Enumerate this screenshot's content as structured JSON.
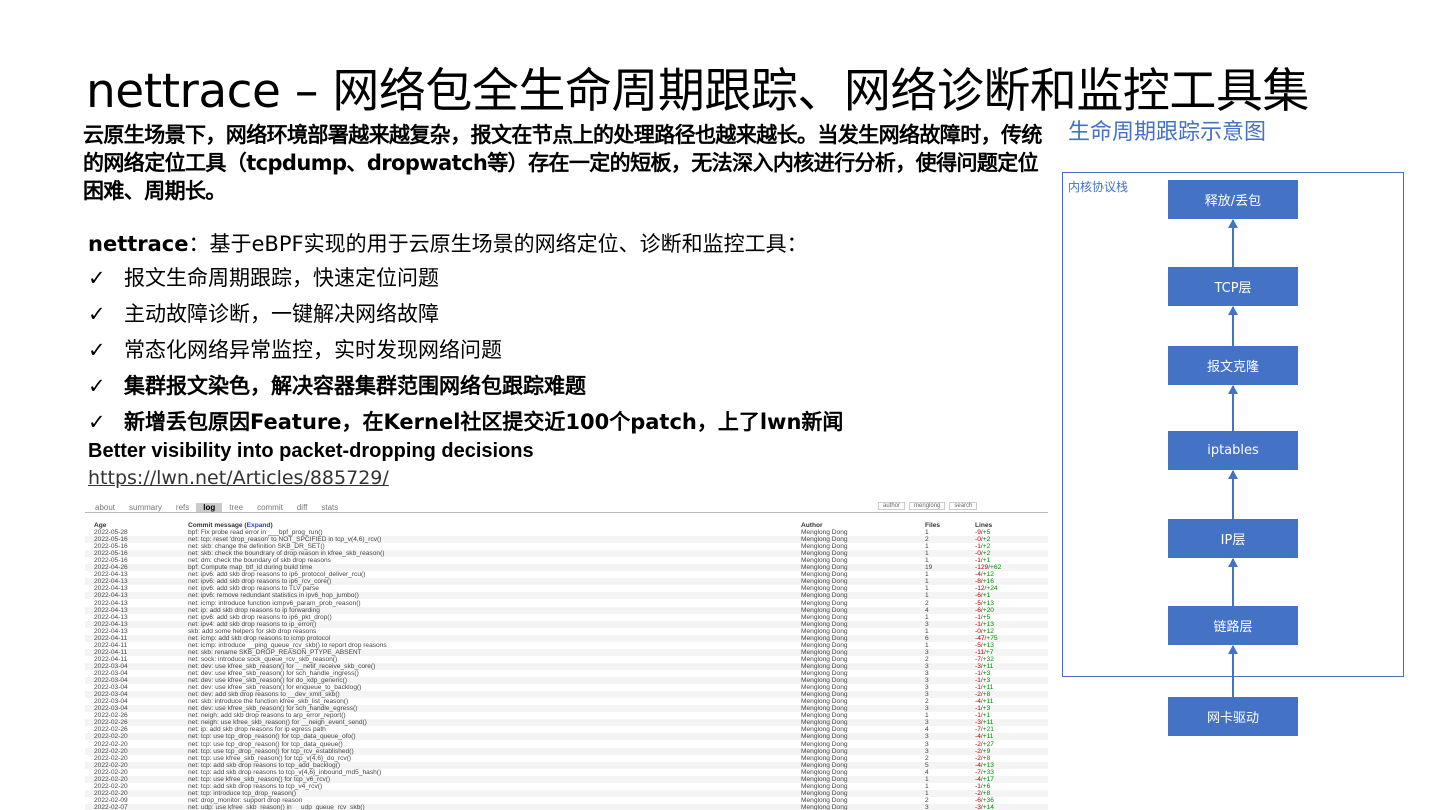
{
  "title": "nettrace – 网络包全生命周期跟踪、网络诊断和监控工具集",
  "intro": "云原生场景下，网络环境部署越来越复杂，报文在节点上的处理路径也越来越长。当发生网络故障时，传统的网络定位工具（tcpdump、dropwatch等）存在一定的短板，无法深入内核进行分析，使得问题定位困难、周期长。",
  "lead_name": "nettrace",
  "lead_text": "：基于eBPF实现的用于云原生场景的网络定位、诊断和监控工具：",
  "check_mark": "✓",
  "features": [
    {
      "text": "报文生命周期跟踪，快速定位问题",
      "bold": false
    },
    {
      "text": "主动故障诊断，一键解决网络故障",
      "bold": false
    },
    {
      "text": "常态化网络异常监控，实时发现网络问题",
      "bold": false
    },
    {
      "text": "集群报文染色，解决容器集群范围网络包跟踪难题",
      "bold": true
    },
    {
      "text": "新增丢包原因Feature，在Kernel社区提交近100个patch，上了lwn新闻",
      "bold": true
    }
  ],
  "better": "Better visibility into packet-dropping decisions",
  "link": "https://lwn.net/Articles/885729/",
  "git": {
    "tabs": [
      "about",
      "summary",
      "refs",
      "log",
      "tree",
      "commit",
      "diff",
      "stats"
    ],
    "active_tab": "log",
    "search_field": "author",
    "search_value": "menglong",
    "search_button": "search",
    "headers": {
      "age": "Age",
      "message": "Commit message (",
      "expand": "Expand",
      "message_end": ")",
      "author": "Author",
      "files": "Files",
      "lines": "Lines"
    },
    "rows": [
      [
        "2022-05-28",
        "bpf: Fix probe read error in ___bpf_prog_run()",
        "Menglong Dong",
        "1",
        "-9",
        "+5"
      ],
      [
        "2022-05-16",
        "net: tcp: reset 'drop_reason' to NOT_SPCIFIED in tcp_v(4,6)_rcv()",
        "Menglong Dong",
        "2",
        "-0",
        "+2"
      ],
      [
        "2022-05-16",
        "net: skb: change the definition SKB_DR_SET()",
        "Menglong Dong",
        "1",
        "-1",
        "+2"
      ],
      [
        "2022-05-16",
        "net: skb: check the boundrary of drop reason in kfree_skb_reason()",
        "Menglong Dong",
        "1",
        "-0",
        "+2"
      ],
      [
        "2022-05-16",
        "net: dm: check the boundary of skb drop reasons",
        "Menglong Dong",
        "1",
        "-1",
        "+1"
      ],
      [
        "2022-04-26",
        "bpf: Compute map_btf_id during build time",
        "Menglong Dong",
        "19",
        "-129",
        "+62"
      ],
      [
        "2022-04-13",
        "net: ipv6: add skb drop reasons to ip6_protocol_deliver_rcu()",
        "Menglong Dong",
        "1",
        "-4",
        "+12"
      ],
      [
        "2022-04-13",
        "net: ipv6: add skb drop reasons to ip6_rcv_core()",
        "Menglong Dong",
        "1",
        "-8",
        "+16"
      ],
      [
        "2022-04-13",
        "net: ipv6: add skb drop reasons to TLV parse",
        "Menglong Dong",
        "1",
        "-12",
        "+24"
      ],
      [
        "2022-04-13",
        "net: ipv6: remove redundant statistics in ipv6_hop_jumbo()",
        "Menglong Dong",
        "1",
        "-6",
        "+1"
      ],
      [
        "2022-04-13",
        "net: icmp: introduce function icmpv6_param_prob_reason()",
        "Menglong Dong",
        "2",
        "-5",
        "+13"
      ],
      [
        "2022-04-13",
        "net: ip: add skb drop reasons to ip forwarding",
        "Menglong Dong",
        "4",
        "-6",
        "+20"
      ],
      [
        "2022-04-13",
        "net: ipv6: add skb drop reasons to ip6_pkt_drop()",
        "Menglong Dong",
        "1",
        "-1",
        "+5"
      ],
      [
        "2022-04-13",
        "net: ipv4: add skb drop reasons to ip_error()",
        "Menglong Dong",
        "3",
        "-1",
        "+13"
      ],
      [
        "2022-04-13",
        "skb: add some helpers for skb drop reasons",
        "Menglong Dong",
        "1",
        "-0",
        "+12"
      ],
      [
        "2022-04-11",
        "net: icmp: add skb drop reasons to icmp protocol",
        "Menglong Dong",
        "6",
        "-47",
        "+75"
      ],
      [
        "2022-04-11",
        "net: icmp: introduce __ping_queue_rcv_skb() to report drop reasons",
        "Menglong Dong",
        "1",
        "-5",
        "+13"
      ],
      [
        "2022-04-11",
        "net: skb: rename SKB_DROP_REASON_PTYPE_ABSENT",
        "Menglong Dong",
        "3",
        "-11",
        "+7"
      ],
      [
        "2022-04-11",
        "net: sock: introduce sock_queue_rcv_skb_reason()",
        "Menglong Dong",
        "2",
        "-7",
        "+32"
      ],
      [
        "2022-03-04",
        "net: dev: use kfree_skb_reason() for __netif_receive_skb_core()",
        "Menglong Dong",
        "3",
        "-3",
        "+11"
      ],
      [
        "2022-03-04",
        "net: dev: use kfree_skb_reason() for sch_handle_ingress()",
        "Menglong Dong",
        "3",
        "-1",
        "+3"
      ],
      [
        "2022-03-04",
        "net: dev: use kfree_skb_reason() for do_xdp_generic()",
        "Menglong Dong",
        "3",
        "-1",
        "+3"
      ],
      [
        "2022-03-04",
        "net: dev: use kfree_skb_reason() for enqueue_to_backlog()",
        "Menglong Dong",
        "3",
        "-1",
        "+11"
      ],
      [
        "2022-03-04",
        "net: dev: add skb drop reasons to __dev_xmit_skb()",
        "Menglong Dong",
        "3",
        "-2",
        "+8"
      ],
      [
        "2022-03-04",
        "net: skb: introduce the function kfree_skb_list_reason()",
        "Menglong Dong",
        "2",
        "-4",
        "+11"
      ],
      [
        "2022-03-04",
        "net: dev: use kfree_skb_reason() for sch_handle_egress()",
        "Menglong Dong",
        "3",
        "-1",
        "+3"
      ],
      [
        "2022-02-26",
        "net: neigh: add skb drop reasons to arp_error_report()",
        "Menglong Dong",
        "1",
        "-1",
        "+1"
      ],
      [
        "2022-02-26",
        "net: neigh: use kfree_skb_reason() for __neigh_event_send()",
        "Menglong Dong",
        "3",
        "-3",
        "+11"
      ],
      [
        "2022-02-26",
        "net: ip: add skb drop reasons for ip egress path",
        "Menglong Dong",
        "4",
        "-7",
        "+21"
      ],
      [
        "2022-02-20",
        "net: tcp: use tcp_drop_reason() for tcp_data_queue_ofo()",
        "Menglong Dong",
        "3",
        "-4",
        "+11"
      ],
      [
        "2022-02-20",
        "net: tcp: use tcp_drop_reason() for tcp_data_queue()",
        "Menglong Dong",
        "3",
        "-2",
        "+27"
      ],
      [
        "2022-02-20",
        "net: tcp: use tcp_drop_reason() for tcp_rcv_established()",
        "Menglong Dong",
        "3",
        "-2",
        "+9"
      ],
      [
        "2022-02-20",
        "net: tcp: use kfree_skb_reason() for tcp_v{4,6}_do_rcv()",
        "Menglong Dong",
        "2",
        "-2",
        "+8"
      ],
      [
        "2022-02-20",
        "net: tcp: add skb drop reasons to tcp_add_backlog()",
        "Menglong Dong",
        "5",
        "-4",
        "+13"
      ],
      [
        "2022-02-20",
        "net: tcp: add skb drop reasons to tcp_v{4,6}_inbound_md5_hash()",
        "Menglong Dong",
        "4",
        "-7",
        "+33"
      ],
      [
        "2022-02-20",
        "net: tcp: use kfree_skb_reason() for tcp_v6_rcv()",
        "Menglong Dong",
        "1",
        "-4",
        "+17"
      ],
      [
        "2022-02-20",
        "net: tcp: add skb drop reasons to tcp_v4_rcv()",
        "Menglong Dong",
        "1",
        "-1",
        "+6"
      ],
      [
        "2022-02-20",
        "net: tcp: introduce tcp_drop_reason()",
        "Menglong Dong",
        "1",
        "-2",
        "+8"
      ],
      [
        "2022-02-09",
        "net: drop_monitor: support drop reason",
        "Menglong Dong",
        "2",
        "-6",
        "+36"
      ],
      [
        "2022-02-07",
        "net: udp: use kfree_skb_reason() in __udp_queue_rcv_skb()",
        "Menglong Dong",
        "3",
        "-3",
        "+14"
      ]
    ]
  },
  "diagram": {
    "caption": "生命周期跟踪示意图",
    "stack_label": "内核协议栈",
    "layers": [
      "释放/丢包",
      "TCP层",
      "报文克隆",
      "iptables",
      "IP层",
      "链路层",
      "网卡驱动"
    ],
    "color": "#4472c4"
  }
}
